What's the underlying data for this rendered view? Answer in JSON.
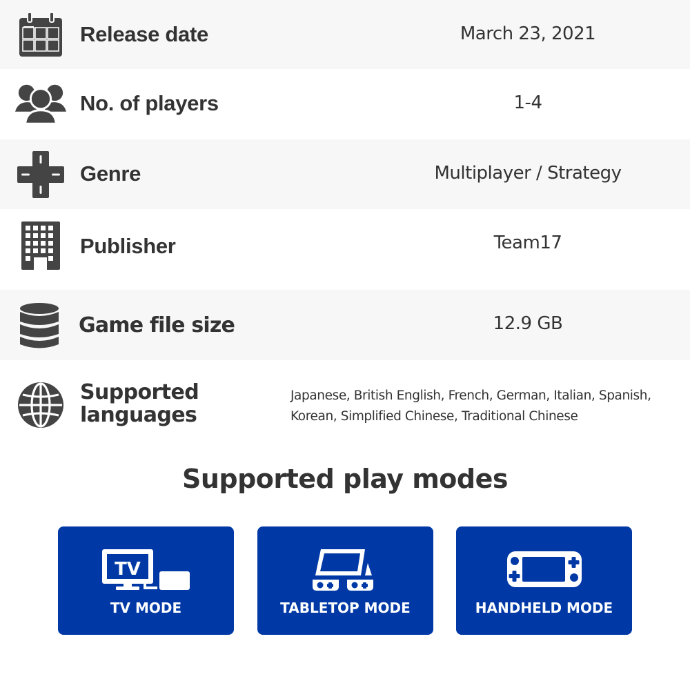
{
  "specs": [
    {
      "icon": "calendar-icon",
      "label": "Release date",
      "value": "March 23, 2021"
    },
    {
      "icon": "players-icon",
      "label": "No. of players",
      "value": "1-4"
    },
    {
      "icon": "dpad-icon",
      "label": "Genre",
      "value": "Multiplayer / Strategy"
    },
    {
      "icon": "building-icon",
      "label": "Publisher",
      "value": "Team17"
    },
    {
      "icon": "database-icon",
      "label": "Game file size",
      "value": "12.9 GB"
    },
    {
      "icon": "globe-icon",
      "label_line1": "Supported",
      "label_line2": "languages",
      "value_line1": "Japanese, British English, French, German, Italian, Spanish,",
      "value_line2": "Korean, Simplified Chinese, Traditional Chinese"
    }
  ],
  "play_modes": {
    "title": "Supported play modes",
    "modes": [
      {
        "icon": "tv-mode-icon",
        "label": "TV MODE",
        "tv_text": "TV"
      },
      {
        "icon": "tabletop-mode-icon",
        "label": "TABLETOP MODE"
      },
      {
        "icon": "handheld-mode-icon",
        "label": "HANDHELD MODE"
      }
    ]
  },
  "colors": {
    "accent": "#0039a6",
    "row_alt": "#f7f7f7",
    "text": "#333333",
    "icon": "#444444"
  }
}
